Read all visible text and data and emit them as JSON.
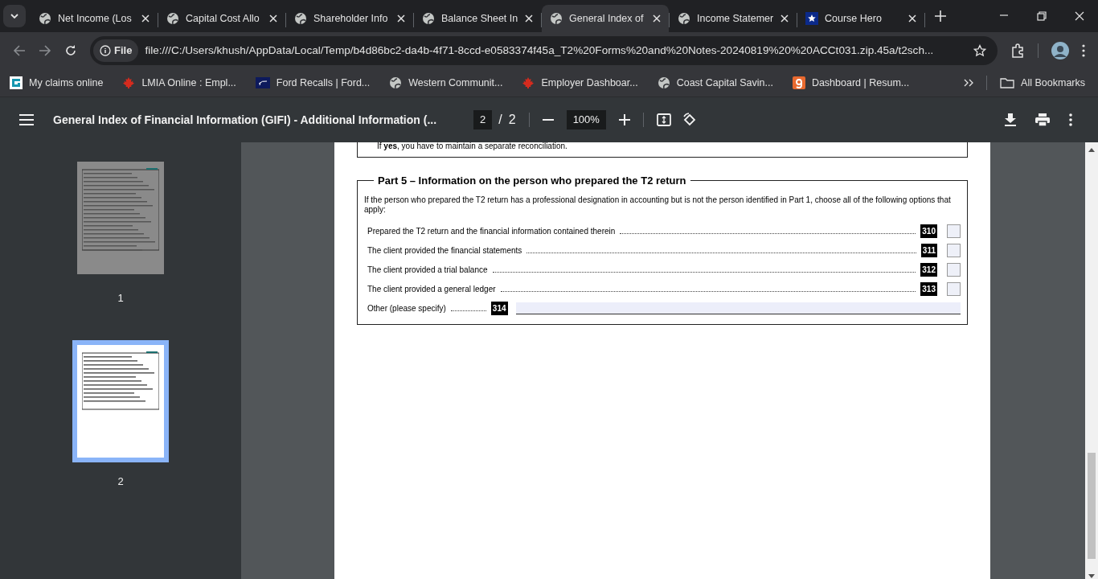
{
  "tabs": [
    {
      "title": "Net Income (Los",
      "kind": "globe",
      "selected": false
    },
    {
      "title": "Capital Cost Allo",
      "kind": "globe",
      "selected": false
    },
    {
      "title": "Shareholder Info",
      "kind": "globe",
      "selected": false
    },
    {
      "title": "Balance Sheet In",
      "kind": "globe",
      "selected": false
    },
    {
      "title": "General Index of",
      "kind": "globe",
      "selected": true
    },
    {
      "title": "Income Statemer",
      "kind": "globe",
      "selected": false
    },
    {
      "title": "Course Hero",
      "kind": "star",
      "selected": false
    }
  ],
  "address_bar": {
    "scheme_label": "File",
    "url": "file:///C:/Users/khush/AppData/Local/Temp/b4d86bc2-da4b-4f71-8ccd-e0583374f45a_T2%20Forms%20and%20Notes-20240819%20%20ACCt031.zip.45a/t2sch..."
  },
  "bookmarks": [
    {
      "label": "My claims online",
      "kind": "square"
    },
    {
      "label": "LMIA Online : Empl...",
      "kind": "leaf"
    },
    {
      "label": "Ford Recalls | Ford...",
      "kind": "navy"
    },
    {
      "label": "Western Communit...",
      "kind": "globe"
    },
    {
      "label": "Employer Dashboar...",
      "kind": "leaf"
    },
    {
      "label": "Coast Capital Savin...",
      "kind": "globe"
    },
    {
      "label": "Dashboard | Resum...",
      "kind": "letter"
    }
  ],
  "all_bookmarks": "All Bookmarks",
  "pdf_toolbar": {
    "title": "General Index of Financial Information (GIFI) - Additional Information (...",
    "page": "2",
    "separator": "/",
    "page_total": "2",
    "zoom": "100%"
  },
  "thumbnails": [
    {
      "label": "1",
      "selected": false
    },
    {
      "label": "2",
      "selected": true
    }
  ],
  "document": {
    "previous_note": "If **yes**, you have to maintain a separate reconciliation.",
    "part_title": "Part 5 – Information on the person who prepared the T2 return",
    "intro": "If the person who prepared the T2 return has a professional designation in accounting but is not the person identified in Part 1, choose all of the following options that apply:",
    "options": [
      {
        "label": "Prepared the T2 return and the financial information contained therein",
        "code": "310",
        "checked": false
      },
      {
        "label": "The client provided the financial statements",
        "code": "311",
        "checked": false
      },
      {
        "label": "The client provided a trial balance",
        "code": "312",
        "checked": false
      },
      {
        "label": "The client provided a general ledger",
        "code": "313",
        "checked": false
      }
    ],
    "other": {
      "label": "Other (please specify)",
      "code": "314"
    }
  }
}
